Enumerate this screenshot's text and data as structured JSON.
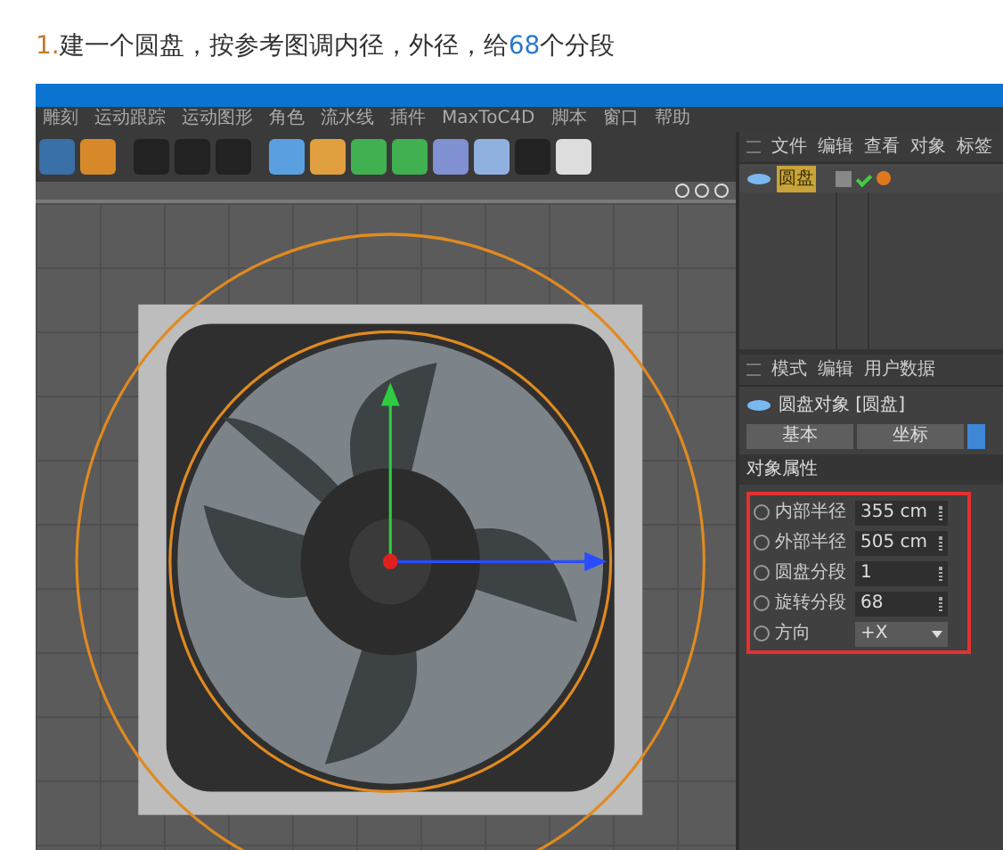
{
  "heading": [
    {
      "text": "1.",
      "kind": "number"
    },
    {
      "text": "建一个圆盘，按参考图调内径，外径，给",
      "kind": "plain"
    },
    {
      "text": "68",
      "kind": "number"
    },
    {
      "text": "个分段",
      "kind": "plain"
    }
  ],
  "menu_bar": [
    "雕刻",
    "运动跟踪",
    "运动图形",
    "角色",
    "流水线",
    "插件",
    "MaxToC4D",
    "脚本",
    "窗口",
    "帮助"
  ],
  "object_manager": {
    "menu": [
      "文件",
      "编辑",
      "查看",
      "对象",
      "标签"
    ],
    "objects": [
      {
        "name": "圆盘",
        "selected": true
      }
    ]
  },
  "attributes": {
    "menu": [
      "模式",
      "编辑",
      "用户数据"
    ],
    "title": "圆盘对象 [圆盘]",
    "tabs": [
      {
        "label": "基本",
        "selected": false
      },
      {
        "label": "坐标",
        "selected": false
      }
    ],
    "section": "对象属性",
    "fields": [
      {
        "label": "内部半径",
        "value": "355 cm",
        "kind": "number"
      },
      {
        "label": "外部半径",
        "value": "505 cm",
        "kind": "number"
      },
      {
        "label": "圆盘分段",
        "value": "1",
        "kind": "number"
      },
      {
        "label": "旋转分段",
        "value": "68",
        "kind": "number"
      },
      {
        "label": "方向",
        "value": "+X",
        "kind": "dropdown"
      }
    ]
  }
}
